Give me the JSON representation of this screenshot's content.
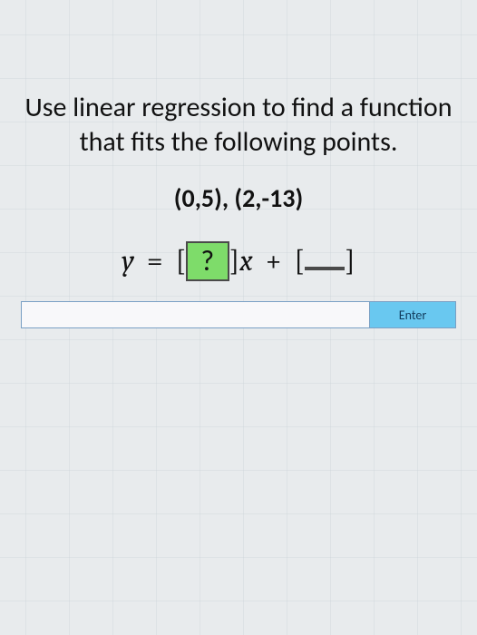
{
  "prompt": "Use linear regression to find a function that fits the following points.",
  "points_text": "(0,5), (2,-13)",
  "equation": {
    "lhs_var": "y",
    "equals": "=",
    "left_bracket": "[",
    "slope_placeholder": "?",
    "right_bracket": "]",
    "x_var": "x",
    "plus": "+",
    "intercept_placeholder": " "
  },
  "input": {
    "value": "",
    "placeholder": ""
  },
  "enter_label": "Enter"
}
